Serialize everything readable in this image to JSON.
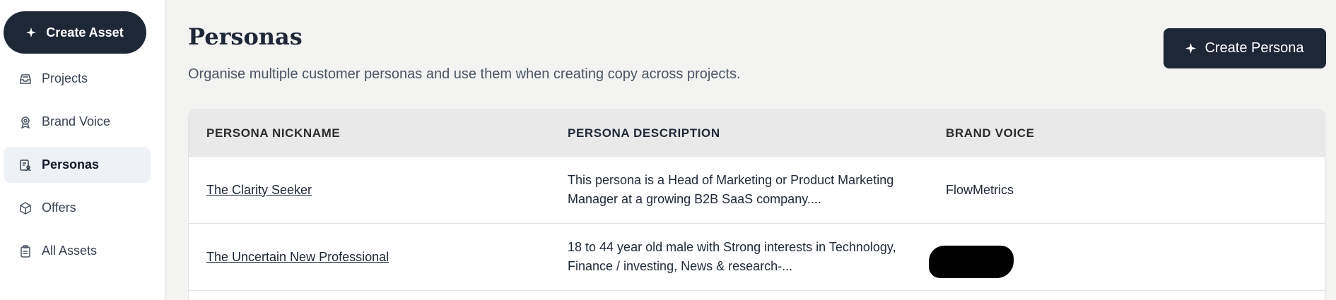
{
  "sidebar": {
    "create_label": "Create Asset",
    "items": [
      {
        "label": "Projects",
        "icon": "projects-icon",
        "active": false
      },
      {
        "label": "Brand Voice",
        "icon": "brand-voice-icon",
        "active": false
      },
      {
        "label": "Personas",
        "icon": "personas-icon",
        "active": true
      },
      {
        "label": "Offers",
        "icon": "offers-icon",
        "active": false
      },
      {
        "label": "All Assets",
        "icon": "all-assets-icon",
        "active": false
      }
    ]
  },
  "header": {
    "title": "Personas",
    "subtitle": "Organise multiple customer personas and use them when creating copy across projects.",
    "create_button_label": "Create Persona"
  },
  "table": {
    "columns": [
      "PERSONA NICKNAME",
      "PERSONA DESCRIPTION",
      "BRAND VOICE"
    ],
    "rows": [
      {
        "nickname": "The Clarity Seeker",
        "description": "This persona is a Head of Marketing or Product Marketing Manager at a growing B2B SaaS company....",
        "brand_voice": "FlowMetrics"
      },
      {
        "nickname": "The Uncertain New Professional",
        "description": "18 to 44 year old male with Strong interests in Technology, Finance / investing, News & research-...",
        "brand_voice": ""
      }
    ]
  },
  "colors": {
    "primary_dark": "#1e2736",
    "active_nav_bg": "#eef1f6",
    "page_bg": "#f3f3f2"
  }
}
